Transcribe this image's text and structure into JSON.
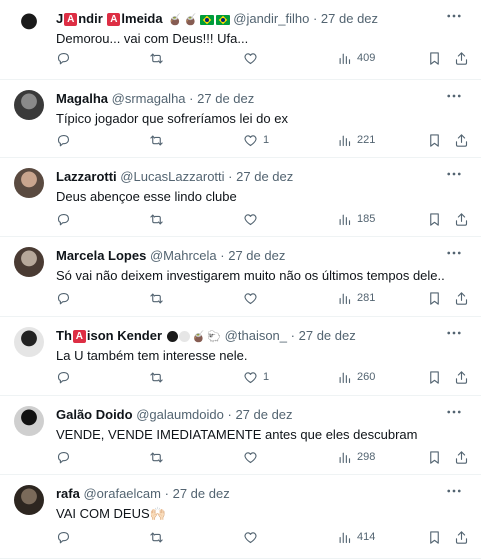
{
  "tweets": [
    {
      "name_prefix": "J",
      "name_mid": "ndir ",
      "name_suffix": "lmeida",
      "name_badge_letter": "A",
      "handle": "@jandir_filho",
      "dot": "·",
      "date": "27 de dez",
      "text": "Demorou... vai com Deus!!! Ufa...",
      "reply_count": "",
      "retweet_count": "",
      "like_count": "",
      "views": "409",
      "avatar_colors": [
        "#1a1a1a",
        "#ffffff"
      ]
    },
    {
      "name": "Magalha",
      "handle": "@srmagalha",
      "dot": "·",
      "date": "27 de dez",
      "text": "Típico jogador que sofreríamos lei do ex",
      "reply_count": "",
      "retweet_count": "",
      "like_count": "1",
      "views": "221",
      "avatar_colors": [
        "#8a8a8a",
        "#3a3a3a"
      ]
    },
    {
      "name": "Lazzarotti",
      "handle": "@LucasLazzarotti",
      "dot": "·",
      "date": "27 de dez",
      "text": "Deus abençoe esse lindo clube",
      "reply_count": "",
      "retweet_count": "",
      "like_count": "",
      "views": "185",
      "avatar_colors": [
        "#c9a58e",
        "#5a4a40"
      ]
    },
    {
      "name": "Marcela Lopes",
      "handle": "@Mahrcela",
      "dot": "·",
      "date": "27 de dez",
      "text": "Só vai não deixem investigarem muito não os últimos tempos dele..",
      "reply_count": "",
      "retweet_count": "",
      "like_count": "",
      "views": "281",
      "avatar_colors": [
        "#b7a89a",
        "#4a3b33"
      ]
    },
    {
      "name_prefix": "Th",
      "name_badge_letter": "A",
      "name_suffix": "ison Kender",
      "handle": "@thaison_",
      "dot": "·",
      "date": "27 de dez",
      "text": "La U também tem interesse nele.",
      "reply_count": "",
      "retweet_count": "",
      "like_count": "1",
      "views": "260",
      "avatar_colors": [
        "#222222",
        "#e5e5e5"
      ]
    },
    {
      "name": "Galão Doido",
      "handle": "@galaumdoido",
      "dot": "·",
      "date": "27 de dez",
      "text": "VENDE, VENDE IMEDIATAMENTE antes que eles descubram",
      "reply_count": "",
      "retweet_count": "",
      "like_count": "",
      "views": "298",
      "avatar_colors": [
        "#111111",
        "#cfcfcf"
      ]
    },
    {
      "name": "rafa",
      "handle": "@orafaelcam",
      "dot": "·",
      "date": "27 de dez",
      "text": "VAI COM DEUS🙌🏻",
      "reply_count": "",
      "retweet_count": "",
      "like_count": "",
      "views": "414",
      "avatar_colors": [
        "#7a6a5a",
        "#2d2620"
      ]
    }
  ],
  "icons": {
    "more": "more-options-icon",
    "reply": "reply-icon",
    "retweet": "retweet-icon",
    "like": "like-icon",
    "views": "views-icon",
    "bookmark": "bookmark-icon",
    "share": "share-icon"
  },
  "emoji": {
    "jandir": [
      "🧉",
      "🧉"
    ],
    "thaison_circles": [
      "#1a1a1a",
      "#e6e6e6"
    ],
    "thaison_emoji": [
      "🧉",
      "🐑"
    ]
  }
}
